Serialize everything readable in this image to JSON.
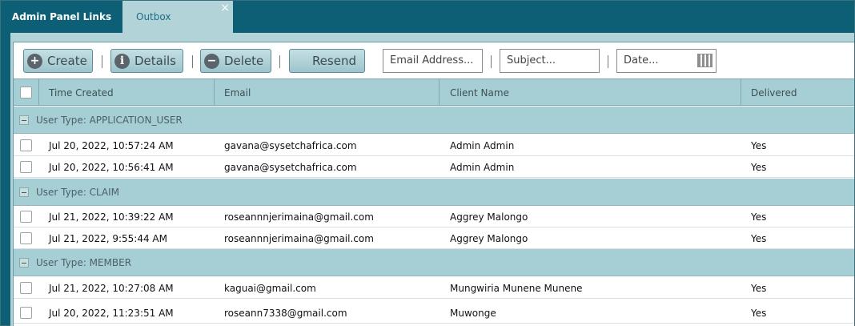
{
  "tabs": [
    {
      "label": "Admin Panel Links"
    },
    {
      "label": "Outbox",
      "close": "×"
    }
  ],
  "toolbar": {
    "create_label": "Create",
    "details_label": "Details",
    "delete_label": "Delete",
    "resend_label": "Resend",
    "email_placeholder": "Email Address...",
    "subject_placeholder": "Subject...",
    "date_placeholder": "Date..."
  },
  "columns": {
    "time_created": "Time Created",
    "email": "Email",
    "client_name": "Client Name",
    "delivered": "Delivered"
  },
  "groups": [
    {
      "label": "User Type: APPLICATION_USER",
      "rows": [
        {
          "time": "Jul 20, 2022, 10:57:24 AM",
          "email": "gavana@sysetchafrica.com",
          "client": "Admin Admin",
          "delivered": "Yes"
        },
        {
          "time": "Jul 20, 2022, 10:56:41 AM",
          "email": "gavana@sysetchafrica.com",
          "client": "Admin Admin",
          "delivered": "Yes"
        }
      ]
    },
    {
      "label": "User Type: CLAIM",
      "rows": [
        {
          "time": "Jul 21, 2022, 10:39:22 AM",
          "email": "roseannnjerimaina@gmail.com",
          "client": "Aggrey Malongo",
          "delivered": "Yes"
        },
        {
          "time": "Jul 21, 2022, 9:55:44 AM",
          "email": "roseannnjerimaina@gmail.com",
          "client": "Aggrey Malongo",
          "delivered": "Yes"
        }
      ]
    },
    {
      "label": "User Type: MEMBER",
      "rows": [
        {
          "time": "Jul 21, 2022, 10:27:08 AM",
          "email": "kaguai@gmail.com",
          "client": "Mungwiria Munene Munene",
          "delivered": "Yes"
        },
        {
          "time": "Jul 20, 2022, 11:23:51 AM",
          "email": "roseann7338@gmail.com",
          "client": "Muwonge",
          "delivered": "Yes"
        }
      ]
    }
  ]
}
